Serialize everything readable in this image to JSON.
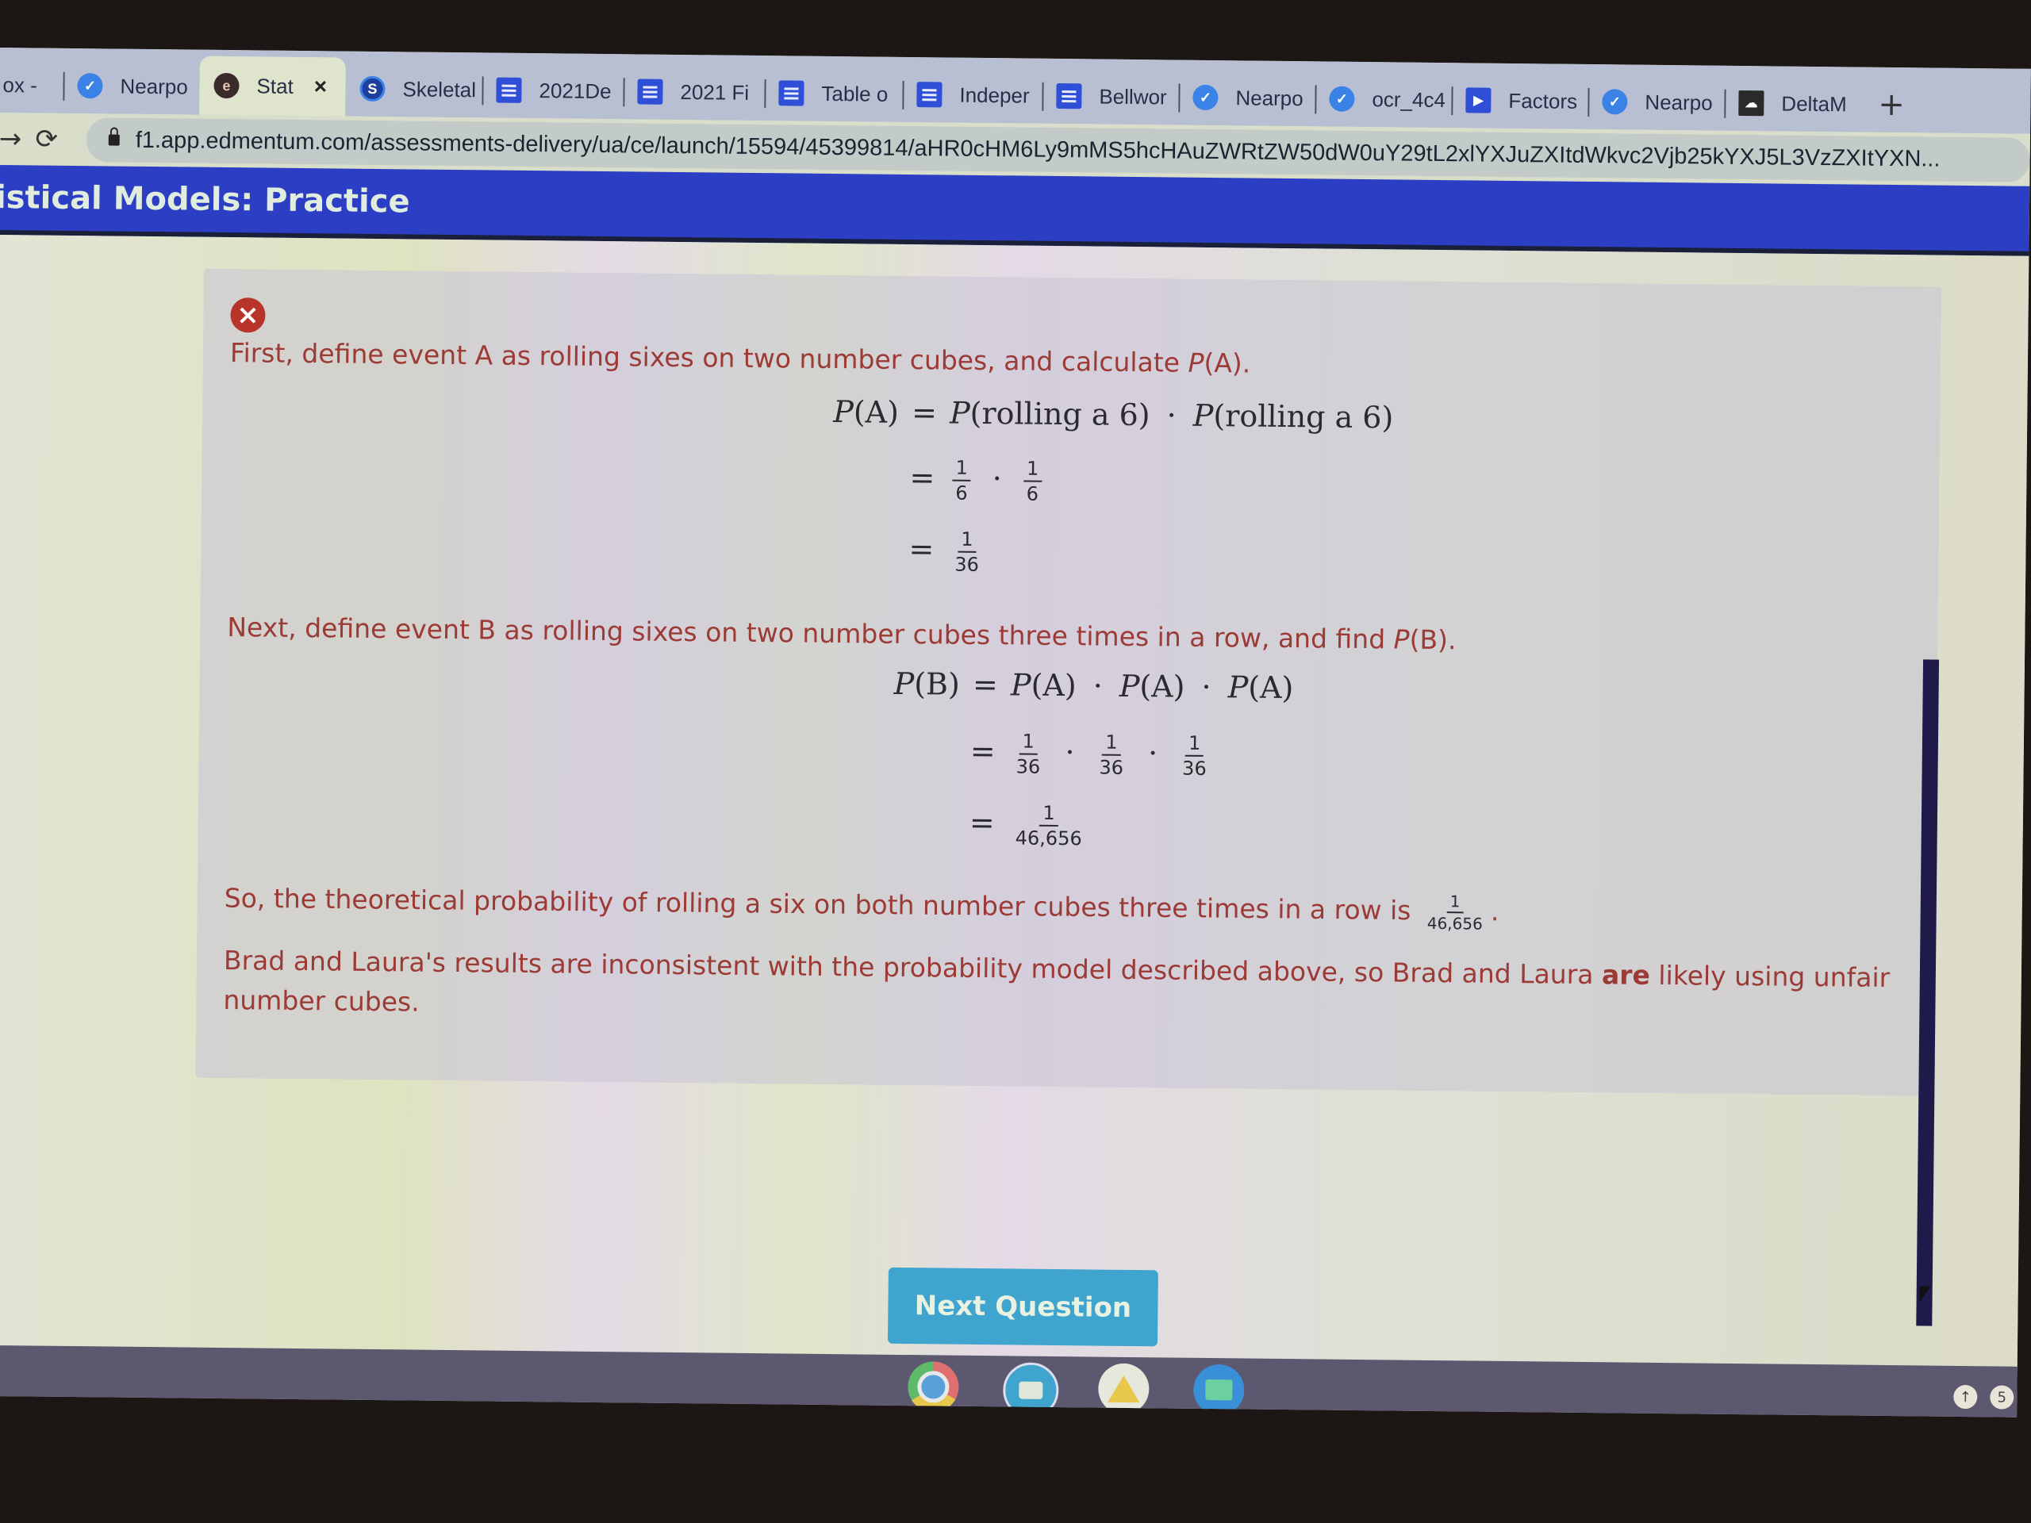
{
  "browser": {
    "tabs": [
      {
        "label": "ox -",
        "icon": "mail-icon",
        "active": false
      },
      {
        "label": "Nearpo",
        "icon": "nearpod-icon",
        "active": false
      },
      {
        "label": "Stat",
        "icon": "edmentum-icon",
        "active": true,
        "close": "×"
      },
      {
        "label": "Skeletal",
        "icon": "schoology-icon",
        "active": false
      },
      {
        "label": "2021De",
        "icon": "docs-icon",
        "active": false
      },
      {
        "label": "2021 Fi",
        "icon": "docs-icon",
        "active": false
      },
      {
        "label": "Table o",
        "icon": "docs-icon",
        "active": false
      },
      {
        "label": "Indeper",
        "icon": "docs-icon",
        "active": false
      },
      {
        "label": "Bellwor",
        "icon": "docs-icon",
        "active": false
      },
      {
        "label": "Nearpo",
        "icon": "nearpod-icon",
        "active": false
      },
      {
        "label": "ocr_4c4",
        "icon": "nearpod-icon",
        "active": false
      },
      {
        "label": "Factors",
        "icon": "play-icon",
        "active": false
      },
      {
        "label": "Nearpo",
        "icon": "nearpod-icon",
        "active": false
      },
      {
        "label": "DeltaM",
        "icon": "deltamath-icon",
        "active": false
      }
    ],
    "new_tab": "+",
    "back": "→",
    "reload": "⟳",
    "url": "f1.app.edmentum.com/assessments-delivery/ua/ce/launch/15594/45399814/aHR0cHM6Ly9mMS5hcHAuZWRtZW50dW0uY29tL2xlYXJuZXItdWkvc2Vjb25kYXJ5L3VzZXItYXN..."
  },
  "app": {
    "title": "istical Models: Practice"
  },
  "feedback": {
    "status_icon": "×",
    "para1": {
      "pre": "First, define event A as rolling sixes on two number cubes, and calculate ",
      "italic": "P",
      "post": "(A)."
    },
    "eqA": {
      "lhs": "P(A)",
      "line1": "P(rolling a 6) · P(rolling a 6)",
      "line1_parts": {
        "p1": "P",
        "t1": "(rolling a 6)",
        "p2": "P",
        "t2": "(rolling a 6)"
      },
      "line2": [
        {
          "num": "1",
          "den": "6"
        },
        {
          "num": "1",
          "den": "6"
        }
      ],
      "line3": {
        "num": "1",
        "den": "36"
      }
    },
    "para2": {
      "pre": "Next, define event B as rolling sixes on two number cubes three times in a row, and find ",
      "italic": "P",
      "post": "(B)."
    },
    "eqB": {
      "lhs_p": "P",
      "lhs_t": "(B)",
      "rhs": [
        {
          "p": "P",
          "t": "(A)"
        },
        {
          "p": "P",
          "t": "(A)"
        },
        {
          "p": "P",
          "t": "(A)"
        }
      ],
      "line2": [
        {
          "num": "1",
          "den": "36"
        },
        {
          "num": "1",
          "den": "36"
        },
        {
          "num": "1",
          "den": "36"
        }
      ],
      "line3": {
        "num": "1",
        "den": "46,656"
      }
    },
    "para3": {
      "text": "So, the theoretical probability of rolling a six on both number cubes three times in a row is ",
      "frac": {
        "num": "1",
        "den": "46,656"
      },
      "end": "."
    },
    "para4": {
      "pre": "Brad and Laura's results are inconsistent with the probability model described above, so Brad and Laura ",
      "bold": "are",
      "post": " likely using unfair",
      "line2": "number cubes."
    }
  },
  "next_button": "Next Question",
  "shelf": {
    "apps": [
      "chrome-icon",
      "meet-icon",
      "drive-icon",
      "files-icon"
    ],
    "tray": [
      "↑",
      "5"
    ]
  },
  "symbols": {
    "eq": "=",
    "dot": "·"
  }
}
